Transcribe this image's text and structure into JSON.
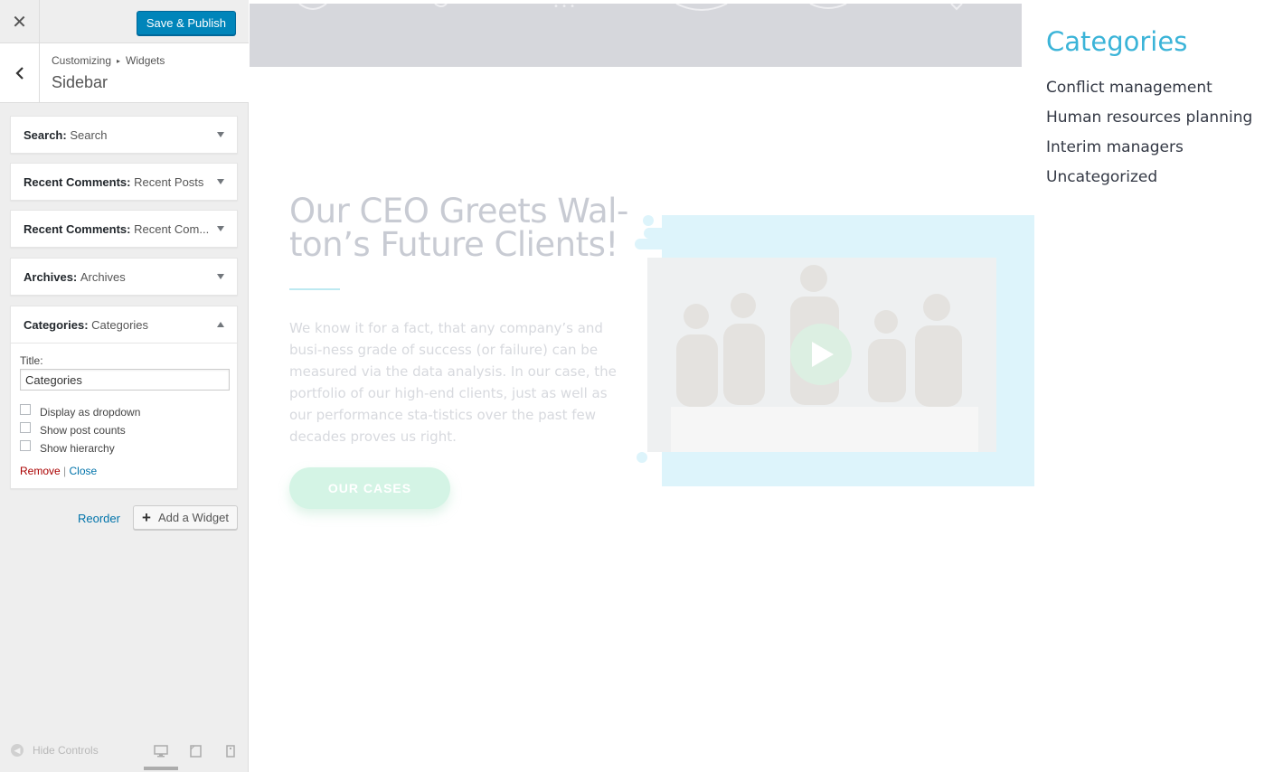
{
  "customizer": {
    "close_icon": "close-icon",
    "publish_label": "Save & Publish",
    "breadcrumb": {
      "root": "Customizing",
      "child": "Widgets"
    },
    "section_title": "Sidebar",
    "widgets": [
      {
        "type": "Search:",
        "title": "Search",
        "expanded": false
      },
      {
        "type": "Recent Comments:",
        "title": "Recent Posts",
        "expanded": false
      },
      {
        "type": "Recent Comments:",
        "title": "Recent Com...",
        "expanded": false
      },
      {
        "type": "Archives:",
        "title": "Archives",
        "expanded": false
      },
      {
        "type": "Categories:",
        "title": "Categories",
        "expanded": true
      }
    ],
    "categories_form": {
      "title_label": "Title:",
      "title_value": "Categories",
      "options": [
        "Display as dropdown",
        "Show post counts",
        "Show hierarchy"
      ],
      "remove_label": "Remove",
      "separator": "|",
      "close_label": "Close"
    },
    "reorder_label": "Reorder",
    "add_widget_label": "Add a Widget",
    "hide_controls_label": "Hide Controls"
  },
  "preview": {
    "hero_title": "Our CEO Greets Wal-ton’s Future Clients!",
    "hero_text": "We know it for a fact, that any company’s and busi-ness grade of success (or failure) can be measured via the data analysis. In our case, the portfolio of our high-end clients, just as well as our performance sta-tistics over the past few decades proves us right.",
    "button_label": "OUR CASES",
    "categories_widget": {
      "title": "Categories",
      "items": [
        "Conflict management",
        "Human resources planning",
        "Interim managers",
        "Uncategorized"
      ]
    }
  },
  "colors": {
    "publish": "#0085ba",
    "link": "#0073aa",
    "remove": "#aa0000",
    "category_title": "#3bb4d8"
  }
}
